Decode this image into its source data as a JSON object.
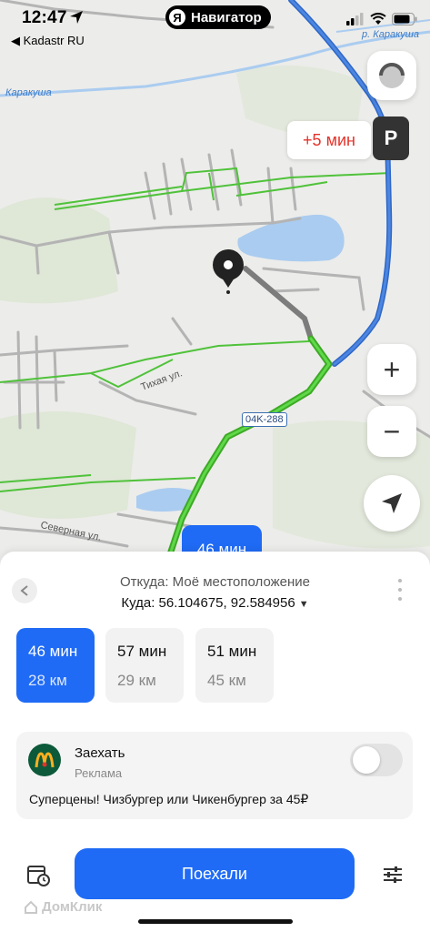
{
  "status_bar": {
    "time": "12:47",
    "back_app": "◀ Kadastr RU",
    "app_pill": "Навигатор",
    "ya_letter": "Я"
  },
  "map": {
    "delay_badge": "+5 мин",
    "parking_label": "P",
    "time_bubble": "46 мин",
    "road_sign": "04K-288",
    "labels": {
      "river_left": "Каракуша",
      "river_right": "р. Каракуша",
      "street_tikhaya": "Тихая ул.",
      "street_severnaya": "Северная ул."
    },
    "zoom_in": "+",
    "zoom_out": "−",
    "colors": {
      "route_main": "#49c531",
      "route_alt": "#2d67c8",
      "route_walk": "#8a8a8a",
      "water": "#aaccf0"
    }
  },
  "panel": {
    "from": "Откуда: Моё местоположение",
    "to": "Куда: 56.104675, 92.584956",
    "routes": [
      {
        "time": "46 мин",
        "distance": "28 км",
        "active": true
      },
      {
        "time": "57 мин",
        "distance": "29 км",
        "active": false
      },
      {
        "time": "51 мин",
        "distance": "45 км",
        "active": false
      }
    ]
  },
  "ad": {
    "title": "Заехать",
    "subtitle": "Реклама",
    "text": "Суперцены! Чизбургер или Чикенбургер за 45₽",
    "toggle_on": false
  },
  "bottom": {
    "go_label": "Поехали",
    "watermark": "ДомКлик"
  }
}
